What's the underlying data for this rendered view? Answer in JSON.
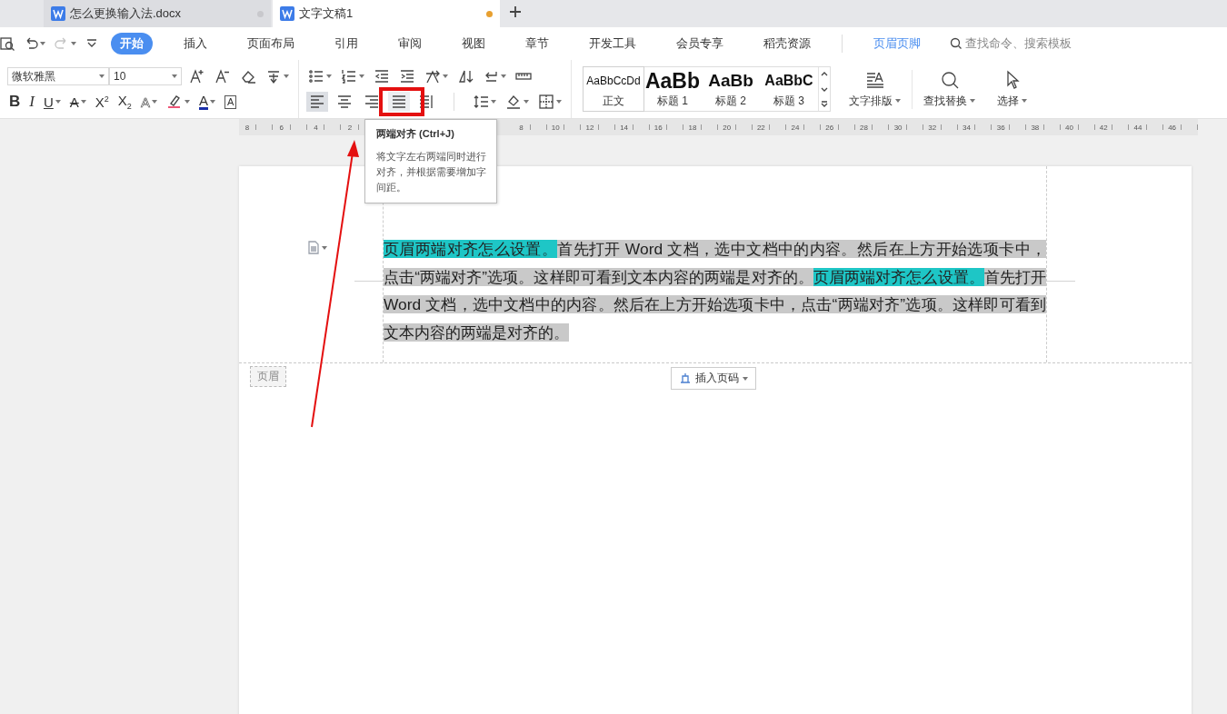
{
  "doc_tabs": [
    {
      "title": "怎么更换输入法.docx",
      "selected": false,
      "modified": false
    },
    {
      "title": "文字文稿1",
      "selected": true,
      "modified": true
    }
  ],
  "quick_access": [
    {
      "kind": "preview",
      "disabled": false
    },
    {
      "kind": "undo",
      "disabled": false
    },
    {
      "kind": "redo",
      "disabled": true
    },
    {
      "kind": "customize",
      "disabled": false
    }
  ],
  "ribbon_tabs": [
    {
      "label": "开始",
      "selected": true,
      "kind": "standard"
    },
    {
      "label": "插入",
      "selected": false,
      "kind": "standard"
    },
    {
      "label": "页面布局",
      "selected": false,
      "kind": "standard"
    },
    {
      "label": "引用",
      "selected": false,
      "kind": "standard"
    },
    {
      "label": "审阅",
      "selected": false,
      "kind": "standard"
    },
    {
      "label": "视图",
      "selected": false,
      "kind": "standard"
    },
    {
      "label": "章节",
      "selected": false,
      "kind": "standard"
    },
    {
      "label": "开发工具",
      "selected": false,
      "kind": "standard"
    },
    {
      "label": "会员专享",
      "selected": false,
      "kind": "standard"
    },
    {
      "label": "稻壳资源",
      "selected": false,
      "kind": "standard"
    },
    {
      "label": "页眉页脚",
      "selected": false,
      "kind": "contextual"
    }
  ],
  "search": {
    "placeholder": "查找命令、搜索模板"
  },
  "font": {
    "name": "微软雅黑",
    "size": "10"
  },
  "format_buttons": [
    {
      "label": "B",
      "kind": "bold",
      "dropdown": false
    },
    {
      "label": "I",
      "kind": "italic",
      "dropdown": false
    },
    {
      "label": "U",
      "kind": "underline",
      "dropdown": true
    },
    {
      "label": "A",
      "kind": "strike",
      "dropdown": true
    },
    {
      "label": "X$^{2}$",
      "kind": "plain",
      "dropdown": false
    },
    {
      "label": "X$_{2}$",
      "kind": "plain",
      "dropdown": false
    },
    {
      "label": "A",
      "kind": "effect",
      "dropdown": true
    },
    {
      "kind": "highlighter",
      "dropdown": true
    },
    {
      "label": "A",
      "kind": "color",
      "dropdown": true
    },
    {
      "label": "A",
      "kind": "boxed",
      "dropdown": false
    }
  ],
  "alignment": [
    {
      "kind": "left",
      "selected": true,
      "hovered": false
    },
    {
      "kind": "center",
      "selected": false,
      "hovered": false
    },
    {
      "kind": "right",
      "selected": false,
      "hovered": false
    },
    {
      "kind": "justify",
      "selected": false,
      "hovered": true
    },
    {
      "kind": "distributed",
      "selected": false,
      "hovered": false
    }
  ],
  "styles": [
    {
      "preview": "AaBbCcDd",
      "label": "正文",
      "selected": true,
      "kind": "body"
    },
    {
      "preview": "AaBb",
      "label": "标题 1",
      "selected": false,
      "kind": "h1"
    },
    {
      "preview": "AaBb",
      "label": "标题 2",
      "selected": false,
      "kind": "h2"
    },
    {
      "preview": "AaBbC",
      "label": "标题 3",
      "selected": false,
      "kind": "h3"
    }
  ],
  "big_buttons": [
    {
      "label": "文字排版",
      "kind": "layout"
    },
    {
      "label": "查找替换",
      "kind": "find"
    },
    {
      "label": "选择",
      "kind": "select"
    }
  ],
  "ruler": {
    "left_labels": [
      "8",
      "6",
      "4",
      "2"
    ],
    "right_labels": [
      "8",
      "10",
      "12",
      "14",
      "16",
      "18",
      "20",
      "22",
      "24",
      "26",
      "28",
      "30",
      "32",
      "34",
      "36",
      "38",
      "40",
      "42",
      "44",
      "46"
    ]
  },
  "tooltip": {
    "title": "两端对齐 (Ctrl+J)",
    "text": "将文字左右两端同时进行对齐，并根据需要增加字间距。"
  },
  "document": {
    "header_segments": [
      {
        "text": "页眉两端对齐怎么设置。",
        "kind": "highlight"
      },
      {
        "text": "首先打开 Word 文档，选中文档中的内容。然后在上方开始选项卡中，点击“两端对齐”选项。这样即可看到文本内容的两端是对齐的。",
        "kind": "selection"
      },
      {
        "text": "页眉两端对齐怎么设置。",
        "kind": "highlight"
      },
      {
        "text": "首先打开 Word 文档，选中文档中的内容。然后在上方开始选项卡中，点击“两端对齐”选项。这样即可看到文本内容的两端是对齐的。",
        "kind": "selection"
      }
    ],
    "header_label": "页眉",
    "insert_page_number": "插入页码"
  }
}
